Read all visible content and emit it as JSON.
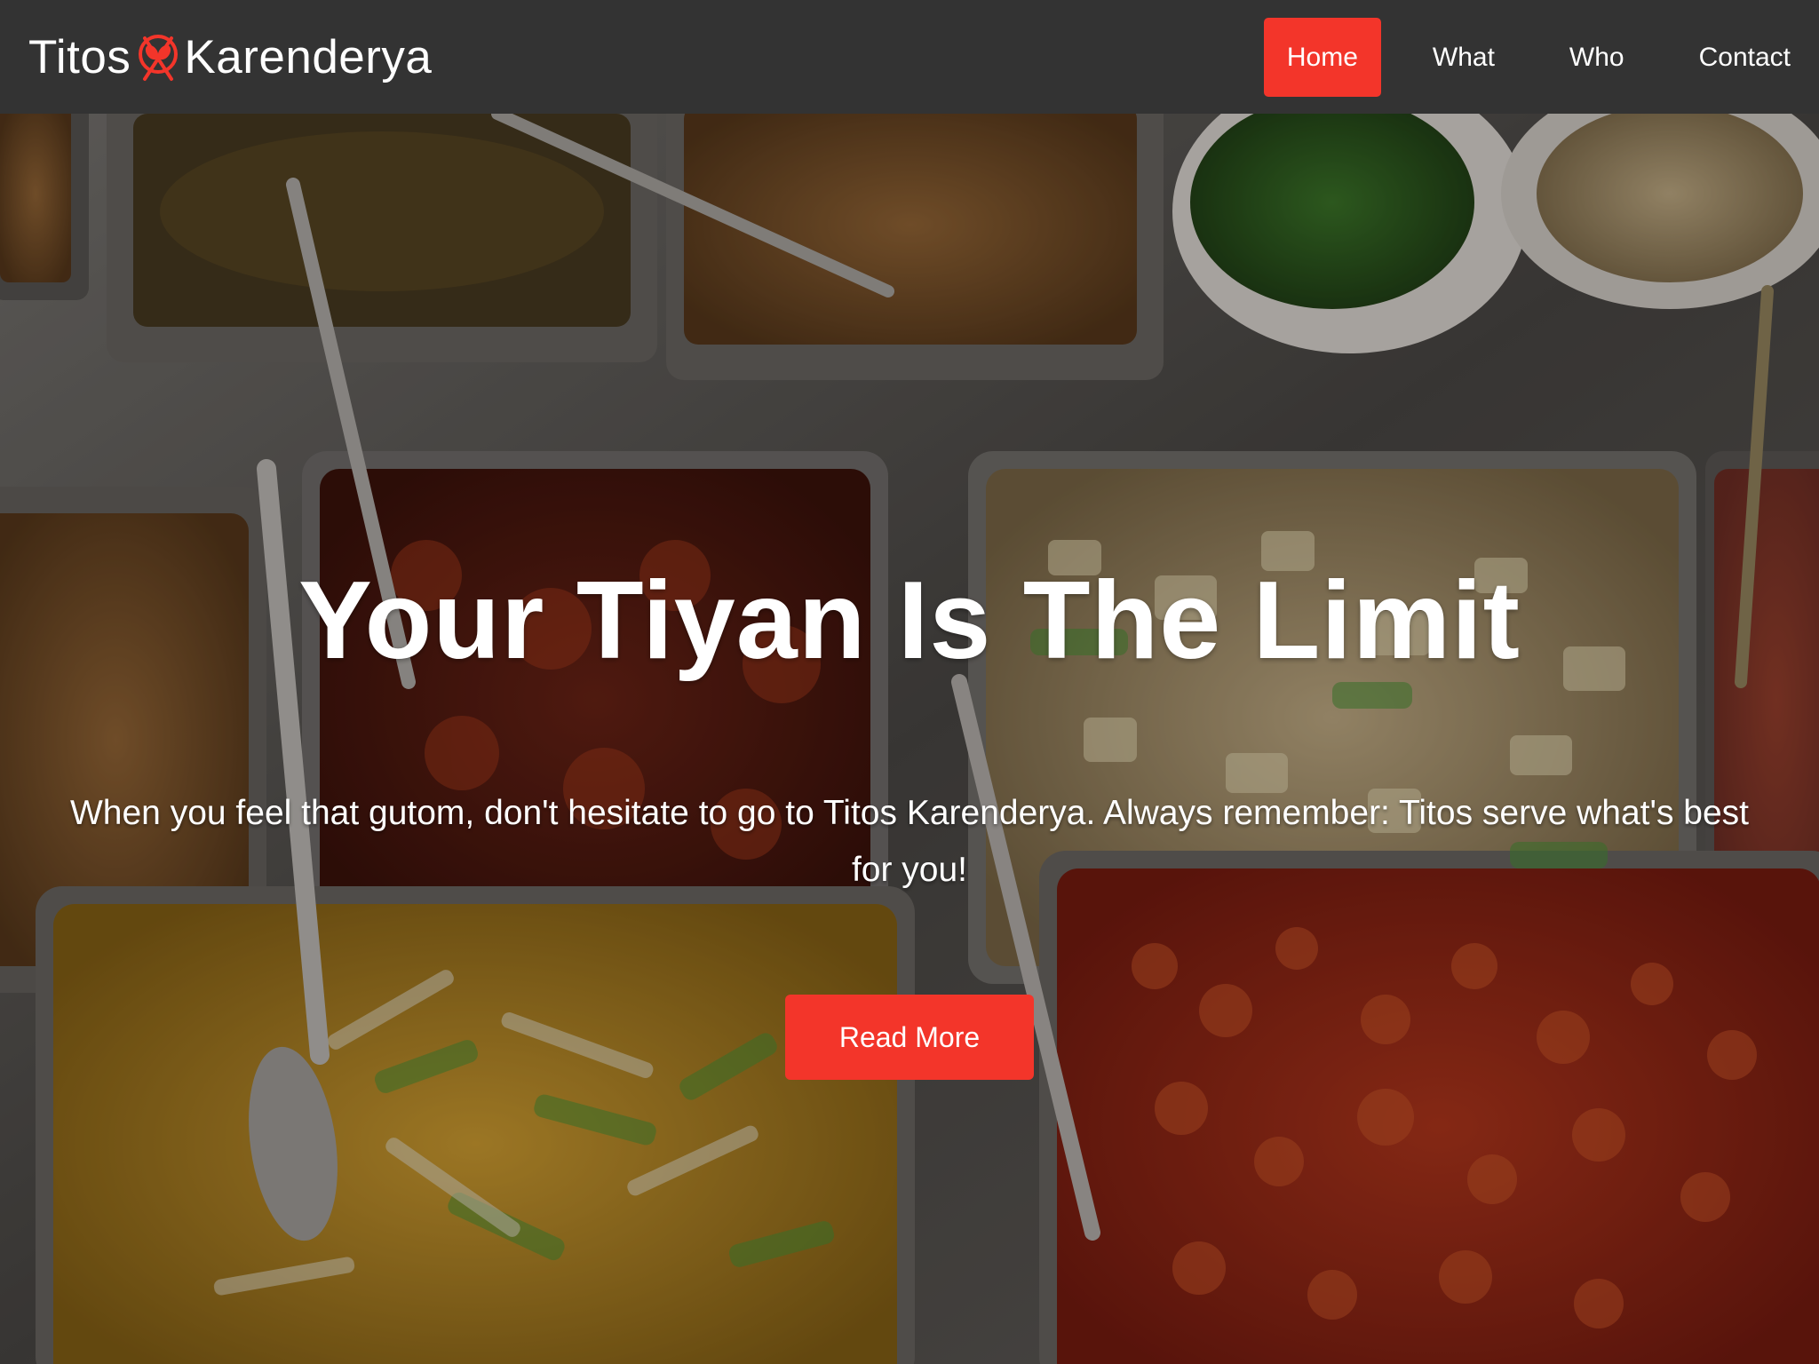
{
  "brand": {
    "name_left": "Titos",
    "name_right": "Karenderya",
    "logo_icon": "fork-spoon-icon"
  },
  "nav": {
    "items": [
      {
        "label": "Home",
        "active": true
      },
      {
        "label": "What",
        "active": false
      },
      {
        "label": "Who",
        "active": false
      },
      {
        "label": "Contact",
        "active": false
      }
    ]
  },
  "hero": {
    "title": "Your Tiyan Is The Limit",
    "text": "When you feel that gutom, don't hesitate to go to Titos Karenderya. Always remember: Titos serve what's best for you!",
    "button_label": "Read More"
  },
  "colors": {
    "navbar_bg": "#333333",
    "accent": "#f3352a",
    "text": "#ffffff"
  }
}
